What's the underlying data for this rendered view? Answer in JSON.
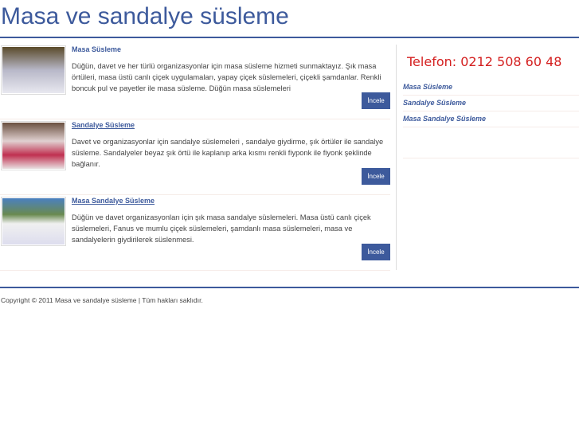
{
  "header": {
    "title": "Masa ve sandalye süsleme"
  },
  "items": [
    {
      "title": "Masa Süsleme",
      "desc": "Düğün, davet ve her türlü organizasyonlar için masa süsleme hizmeti sunmaktayız. Şık masa örtüleri, masa üstü canlı çiçek uygulamaları, yapay çiçek süslemeleri, çiçekli şamdanlar. Renkli boncuk pul ve payetler ile masa süsleme. Düğün masa süslemeleri",
      "button": "İncele"
    },
    {
      "title": "Sandalye Süsleme",
      "desc": "Davet ve organizasyonlar için sandalye süslemeleri , sandalye giydirme, şık örtüler ile sandalye süsleme. Sandalyeler beyaz şık örtü ile kaplanıp arka kısmı renkli fiyponk ile fiyonk şeklinde bağlanır.",
      "button": "İncele"
    },
    {
      "title": "Masa Sandalye Süsleme",
      "desc": "Düğün ve davet organizasyonları için şık masa sandalye süslemeleri. Masa üstü canlı çiçek süslemeleri, Fanus ve mumlu çiçek süslemeleri, şamdanlı masa süslemeleri, masa ve sandalyelerin giydirilerek süslenmesi.",
      "button": "İncele"
    }
  ],
  "sidebar": {
    "phone": "Telefon: 0212 508 60 48",
    "links": [
      "Masa Süsleme",
      "Sandalye Süsleme",
      "Masa Sandalye Süsleme"
    ]
  },
  "footer": {
    "copyright": "Copyright © 2011 Masa ve sandalye süsleme | Tüm hakları saklıdır."
  }
}
